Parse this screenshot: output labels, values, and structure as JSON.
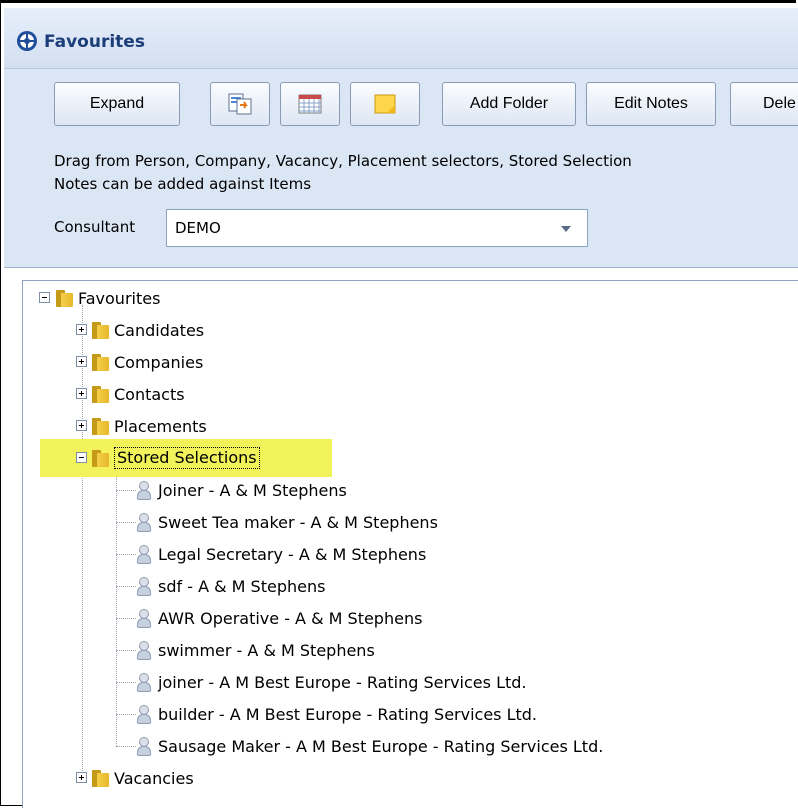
{
  "window": {
    "title": "Favourites"
  },
  "toolbar": {
    "expand_label": "Expand",
    "add_folder_label": "Add Folder",
    "edit_notes_label": "Edit Notes",
    "delete_label": "Dele"
  },
  "description": {
    "line1": "Drag from Person, Company, Vacancy, Placement selectors, Stored Selection",
    "line2": "Notes can be added against Items"
  },
  "consultant": {
    "label": "Consultant",
    "value": "DEMO"
  },
  "tree": {
    "root": "Favourites",
    "folders": {
      "candidates": "Candidates",
      "companies": "Companies",
      "contacts": "Contacts",
      "placements": "Placements",
      "stored_selections": "Stored Selections",
      "vacancies": "Vacancies"
    },
    "stored_items": [
      "Joiner - A & M Stephens",
      "Sweet Tea maker - A & M Stephens",
      "Legal Secretary - A & M Stephens",
      "sdf - A & M Stephens",
      "AWR Operative - A & M Stephens",
      "swimmer - A & M Stephens",
      "joiner - A M  Best Europe - Rating Services Ltd.",
      "builder - A M  Best Europe - Rating Services Ltd.",
      "Sausage Maker - A M  Best Europe - Rating Services Ltd."
    ]
  },
  "colors": {
    "highlight": "#f2f35a",
    "title_text": "#1b3d78",
    "panel_bg": "#dbe6f5"
  }
}
